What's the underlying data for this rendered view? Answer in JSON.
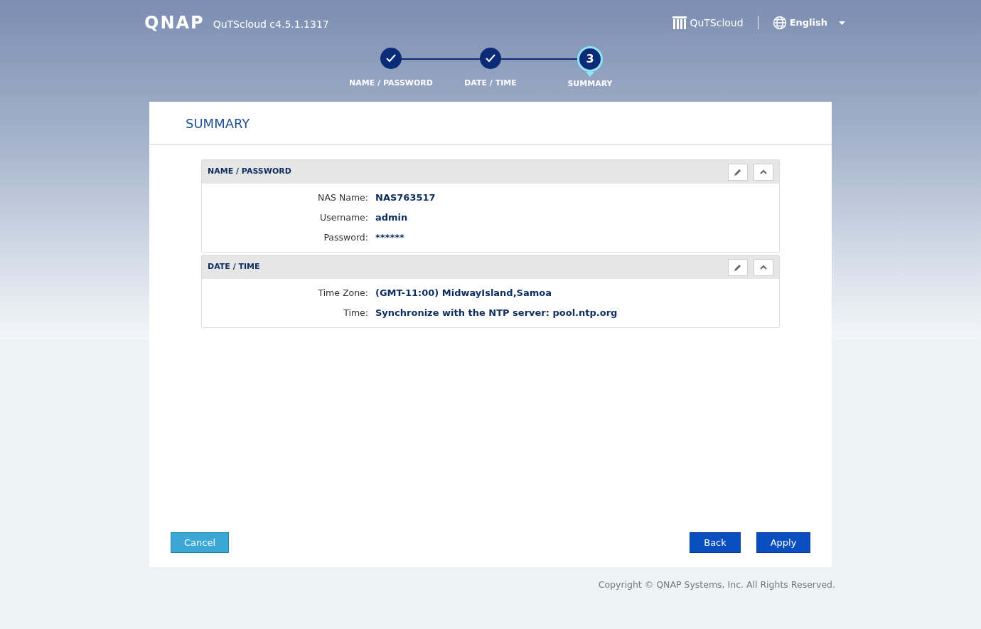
{
  "header": {
    "logo": "QNAP",
    "product": "QuTScloud c4.5.1.1317",
    "app_link": "QuTScloud",
    "language": "English"
  },
  "steps": [
    {
      "label": "NAME / PASSWORD",
      "done": true,
      "selected": false
    },
    {
      "label": "DATE / TIME",
      "done": true,
      "selected": false
    },
    {
      "label": "SUMMARY",
      "selected": true,
      "number": "3"
    }
  ],
  "panel": {
    "title": "SUMMARY",
    "sections": [
      {
        "title": "NAME / PASSWORD",
        "expanded": true,
        "fields": [
          {
            "label": "NAS Name:",
            "value": "NAS763517"
          },
          {
            "label": "Username:",
            "value": "admin"
          },
          {
            "label": "Password:",
            "value": "******"
          }
        ]
      },
      {
        "title": "DATE / TIME",
        "expanded": true,
        "fields": [
          {
            "label": "Time Zone:",
            "value": "(GMT-11:00) MidwayIsland,Samoa"
          },
          {
            "label": "Time:",
            "value": "Synchronize with the NTP server: pool.ntp.org"
          }
        ]
      }
    ],
    "buttons": [
      {
        "label": "Cancel",
        "kind": "secondary"
      },
      {
        "label": "Back",
        "kind": "primary"
      },
      {
        "label": "Apply",
        "kind": "primary"
      }
    ]
  },
  "footer": "Copyright © QNAP Systems, Inc. All Rights Reserved."
}
